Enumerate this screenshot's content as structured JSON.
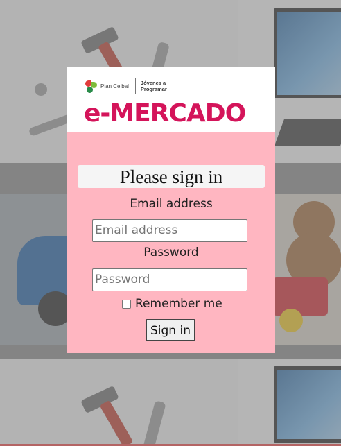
{
  "background": {
    "tiles": [
      "tools-photo",
      "computer-photo",
      "car-photo",
      "toys-photo",
      "tools-photo",
      "computer-photo"
    ]
  },
  "header": {
    "plan_ceibal": "Plan Ceibal",
    "jovenes": "Jóvenes a Programar",
    "brand": "e-MERCADO"
  },
  "form": {
    "title": "Please sign in",
    "email_label": "Email address",
    "email_placeholder": "Email address",
    "email_value": "",
    "password_label": "Password",
    "password_placeholder": "Password",
    "password_value": "",
    "remember_label": "Remember me",
    "remember_checked": false,
    "submit_label": "Sign in"
  },
  "colors": {
    "card_bg": "#ffb6c1",
    "brand": "#d4145a"
  }
}
